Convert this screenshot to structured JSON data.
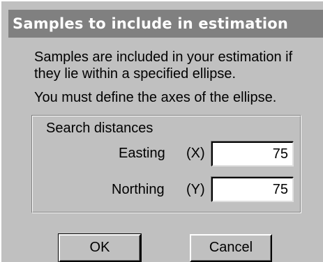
{
  "dialog": {
    "title": "Samples to include in estimation",
    "description_line1": "Samples are included in your estimation if",
    "description_line2": "they lie within a specified ellipse.",
    "description_line3": "You must define the axes of the ellipse."
  },
  "search_distances": {
    "group_label": "Search distances",
    "easting": {
      "label": "Easting",
      "axis": "(X)",
      "value": "75"
    },
    "northing": {
      "label": "Northing",
      "axis": "(Y)",
      "value": "75"
    }
  },
  "buttons": {
    "ok_label": "OK",
    "cancel_label": "Cancel"
  },
  "colors": {
    "dialog_background": "#c0c0c0",
    "titlebar_background": "#808080",
    "titlebar_text": "#ffffff"
  }
}
